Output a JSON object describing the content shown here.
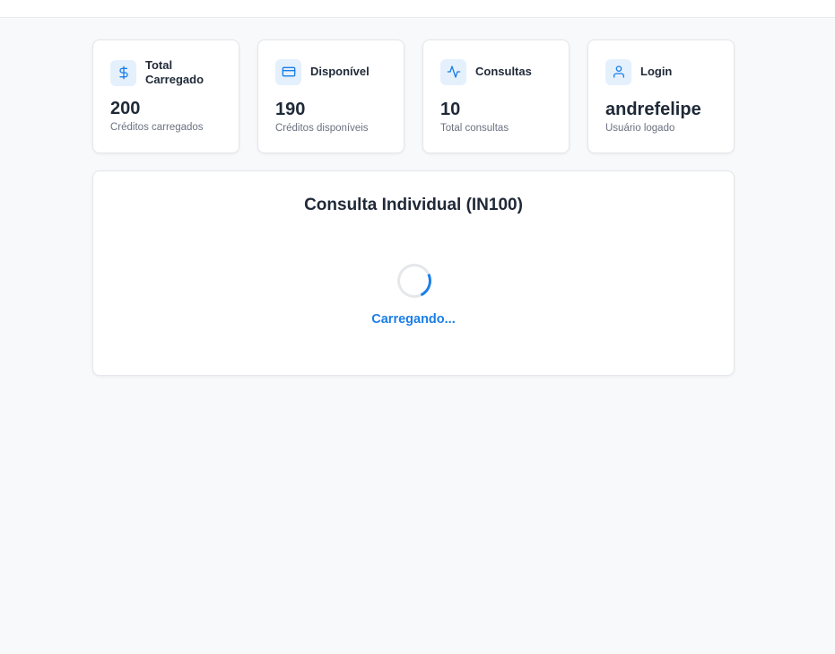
{
  "cards": [
    {
      "icon": "dollar-icon",
      "label": "Total Carregado",
      "value": "200",
      "sub": "Créditos carregados"
    },
    {
      "icon": "credit-card-icon",
      "label": "Disponível",
      "value": "190",
      "sub": "Créditos disponíveis"
    },
    {
      "icon": "activity-icon",
      "label": "Consultas",
      "value": "10",
      "sub": "Total consultas"
    },
    {
      "icon": "user-icon",
      "label": "Login",
      "value": "andrefelipe",
      "sub": "Usuário logado"
    }
  ],
  "panel": {
    "title": "Consulta Individual (IN100)",
    "loading_text": "Carregando..."
  },
  "colors": {
    "accent": "#1a7ee8",
    "icon_bg": "#e5f0fd",
    "background": "#f8f9fb"
  }
}
